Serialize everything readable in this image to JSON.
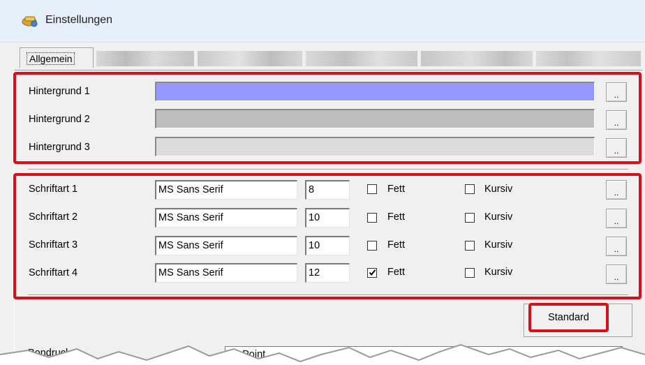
{
  "window": {
    "title": "Einstellungen"
  },
  "tabs": [
    {
      "label": "Allgemein",
      "active": true
    }
  ],
  "background_rows": [
    {
      "label": "Hintergrund 1",
      "color": "#9696ff",
      "button": ".."
    },
    {
      "label": "Hintergrund 2",
      "color": "#bdbdbd",
      "button": ".."
    },
    {
      "label": "Hintergrund 3",
      "color": "#dcdcdc",
      "button": ".."
    }
  ],
  "font_rows": [
    {
      "label": "Schriftart 1",
      "font": "MS Sans Serif",
      "size": "8",
      "bold": false,
      "italic": false,
      "bold_label": "Fett",
      "italic_label": "Kursiv",
      "button": ".."
    },
    {
      "label": "Schriftart 2",
      "font": "MS Sans Serif",
      "size": "10",
      "bold": false,
      "italic": false,
      "bold_label": "Fett",
      "italic_label": "Kursiv",
      "button": ".."
    },
    {
      "label": "Schriftart 3",
      "font": "MS Sans Serif",
      "size": "10",
      "bold": false,
      "italic": false,
      "bold_label": "Fett",
      "italic_label": "Kursiv",
      "button": ".."
    },
    {
      "label": "Schriftart 4",
      "font": "MS Sans Serif",
      "size": "12",
      "bold": true,
      "italic": false,
      "bold_label": "Fett",
      "italic_label": "Kursiv",
      "button": ".."
    }
  ],
  "standard_button": "Standard",
  "bottom": {
    "label": "Bondrucker",
    "select_value": "Fit Point"
  },
  "colors": {
    "highlight": "#d3131b",
    "titlebar": "#e5f0fb",
    "window_bg": "#f0f0f0"
  },
  "icons": {
    "title": "settings-app-icon",
    "checkmark": "check-icon",
    "dropdown": "chevron-down-icon"
  }
}
